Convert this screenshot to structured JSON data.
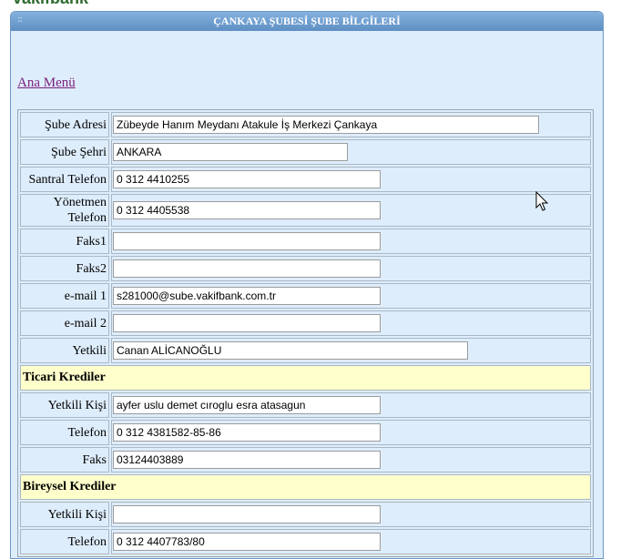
{
  "window": {
    "title": "ÇANKAYA ŞUBESİ ŞUBE BİLGİLERİ"
  },
  "nav": {
    "menu_link": "Ana Menü"
  },
  "branch": [
    {
      "label": "Şube Adresi",
      "value": "Zübeyde Hanım Meydanı Atakule İş Merkezi Çankaya"
    },
    {
      "label": "Şube Şehri",
      "value": "ANKARA"
    },
    {
      "label": "Santral Telefon",
      "value": "0 312 4410255"
    },
    {
      "label": "Yönetmen Telefon",
      "value": "0 312 4405538"
    },
    {
      "label": "Faks1",
      "value": ""
    },
    {
      "label": "Faks2",
      "value": ""
    },
    {
      "label": "e-mail 1",
      "value": "s281000@sube.vakifbank.com.tr"
    },
    {
      "label": "e-mail 2",
      "value": ""
    },
    {
      "label": "Yetkili",
      "value": "Canan ALİCANOĞLU"
    }
  ],
  "commercial": {
    "heading": "Ticari Krediler",
    "rows": [
      {
        "label": "Yetkili Kişi",
        "value": "ayfer uslu demet cıroglu esra atasagun"
      },
      {
        "label": "Telefon",
        "value": "0 312 4381582-85-86"
      },
      {
        "label": "Faks",
        "value": "03124403889"
      }
    ]
  },
  "retail": {
    "heading": "Bireysel Krediler",
    "rows": [
      {
        "label": "Yetkili Kişi",
        "value": ""
      },
      {
        "label": "Telefon",
        "value": "0 312 4407783/80"
      }
    ]
  },
  "icons": {
    "cursor": "mouse-pointer-icon",
    "grip": "grip-icon"
  },
  "colors": {
    "header": "#6f9fd1",
    "panel": "#deedfc",
    "section": "#ffffcc",
    "link": "#7a1f7a"
  }
}
